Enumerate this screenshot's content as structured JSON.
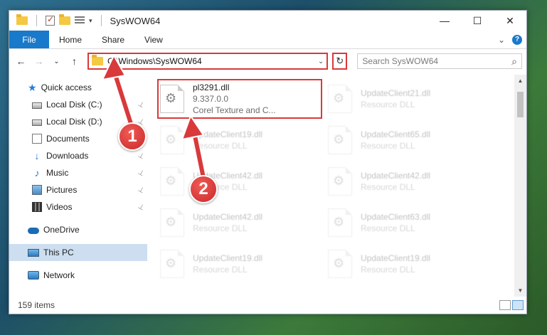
{
  "window": {
    "title": "SysWOW64",
    "controls": {
      "minimize": "—",
      "maximize": "☐",
      "close": "✕"
    }
  },
  "ribbon": {
    "tabs": [
      "File",
      "Home",
      "Share",
      "View"
    ],
    "expand_glyph": "⌄",
    "help_glyph": "?"
  },
  "navbar": {
    "back": "←",
    "forward": "→",
    "recent": "⌄",
    "up": "↑",
    "address": "C:\\Windows\\SysWOW64",
    "address_chevron": "⌄",
    "refresh": "↻",
    "search_placeholder": "Search SysWOW64",
    "search_icon": "⌕"
  },
  "sidebar": {
    "quick_access": "Quick access",
    "items": [
      {
        "label": "Local Disk (C:)",
        "icon": "disk-icon",
        "pinned": true
      },
      {
        "label": "Local Disk (D:)",
        "icon": "disk-icon",
        "pinned": true
      },
      {
        "label": "Documents",
        "icon": "documents-icon",
        "pinned": true
      },
      {
        "label": "Downloads",
        "icon": "downloads-icon",
        "pinned": true
      },
      {
        "label": "Music",
        "icon": "music-icon",
        "pinned": true
      },
      {
        "label": "Pictures",
        "icon": "pictures-icon",
        "pinned": true
      },
      {
        "label": "Videos",
        "icon": "videos-icon",
        "pinned": true
      }
    ],
    "onedrive": "OneDrive",
    "this_pc": "This PC",
    "network": "Network",
    "pin_glyph": "📌"
  },
  "files": [
    {
      "name": "pl3291.dll",
      "line2": "9.337.0.0",
      "line3": "Corel Texture and C...",
      "highlighted": true
    },
    {
      "name": "UpdateClient21.dll",
      "line2": "Resource DLL"
    },
    {
      "name": "UpdateClient19.dll",
      "line2": "Resource DLL"
    },
    {
      "name": "UpdateClient65.dll",
      "line2": "Resource DLL"
    },
    {
      "name": "UpdateClient42.dll",
      "line2": "Resource DLL"
    },
    {
      "name": "UpdateClient42.dll",
      "line2": "Resource DLL"
    },
    {
      "name": "UpdateClient42.dll",
      "line2": "Resource DLL"
    },
    {
      "name": "UpdateClient63.dll",
      "line2": "Resource DLL"
    },
    {
      "name": "UpdateClient19.dll",
      "line2": "Resource DLL"
    },
    {
      "name": "UpdateClient19.dll",
      "line2": "Resource DLL"
    }
  ],
  "status": {
    "item_count": "159 items"
  },
  "annotations": {
    "step1": "1",
    "step2": "2",
    "color": "#d9393b"
  }
}
